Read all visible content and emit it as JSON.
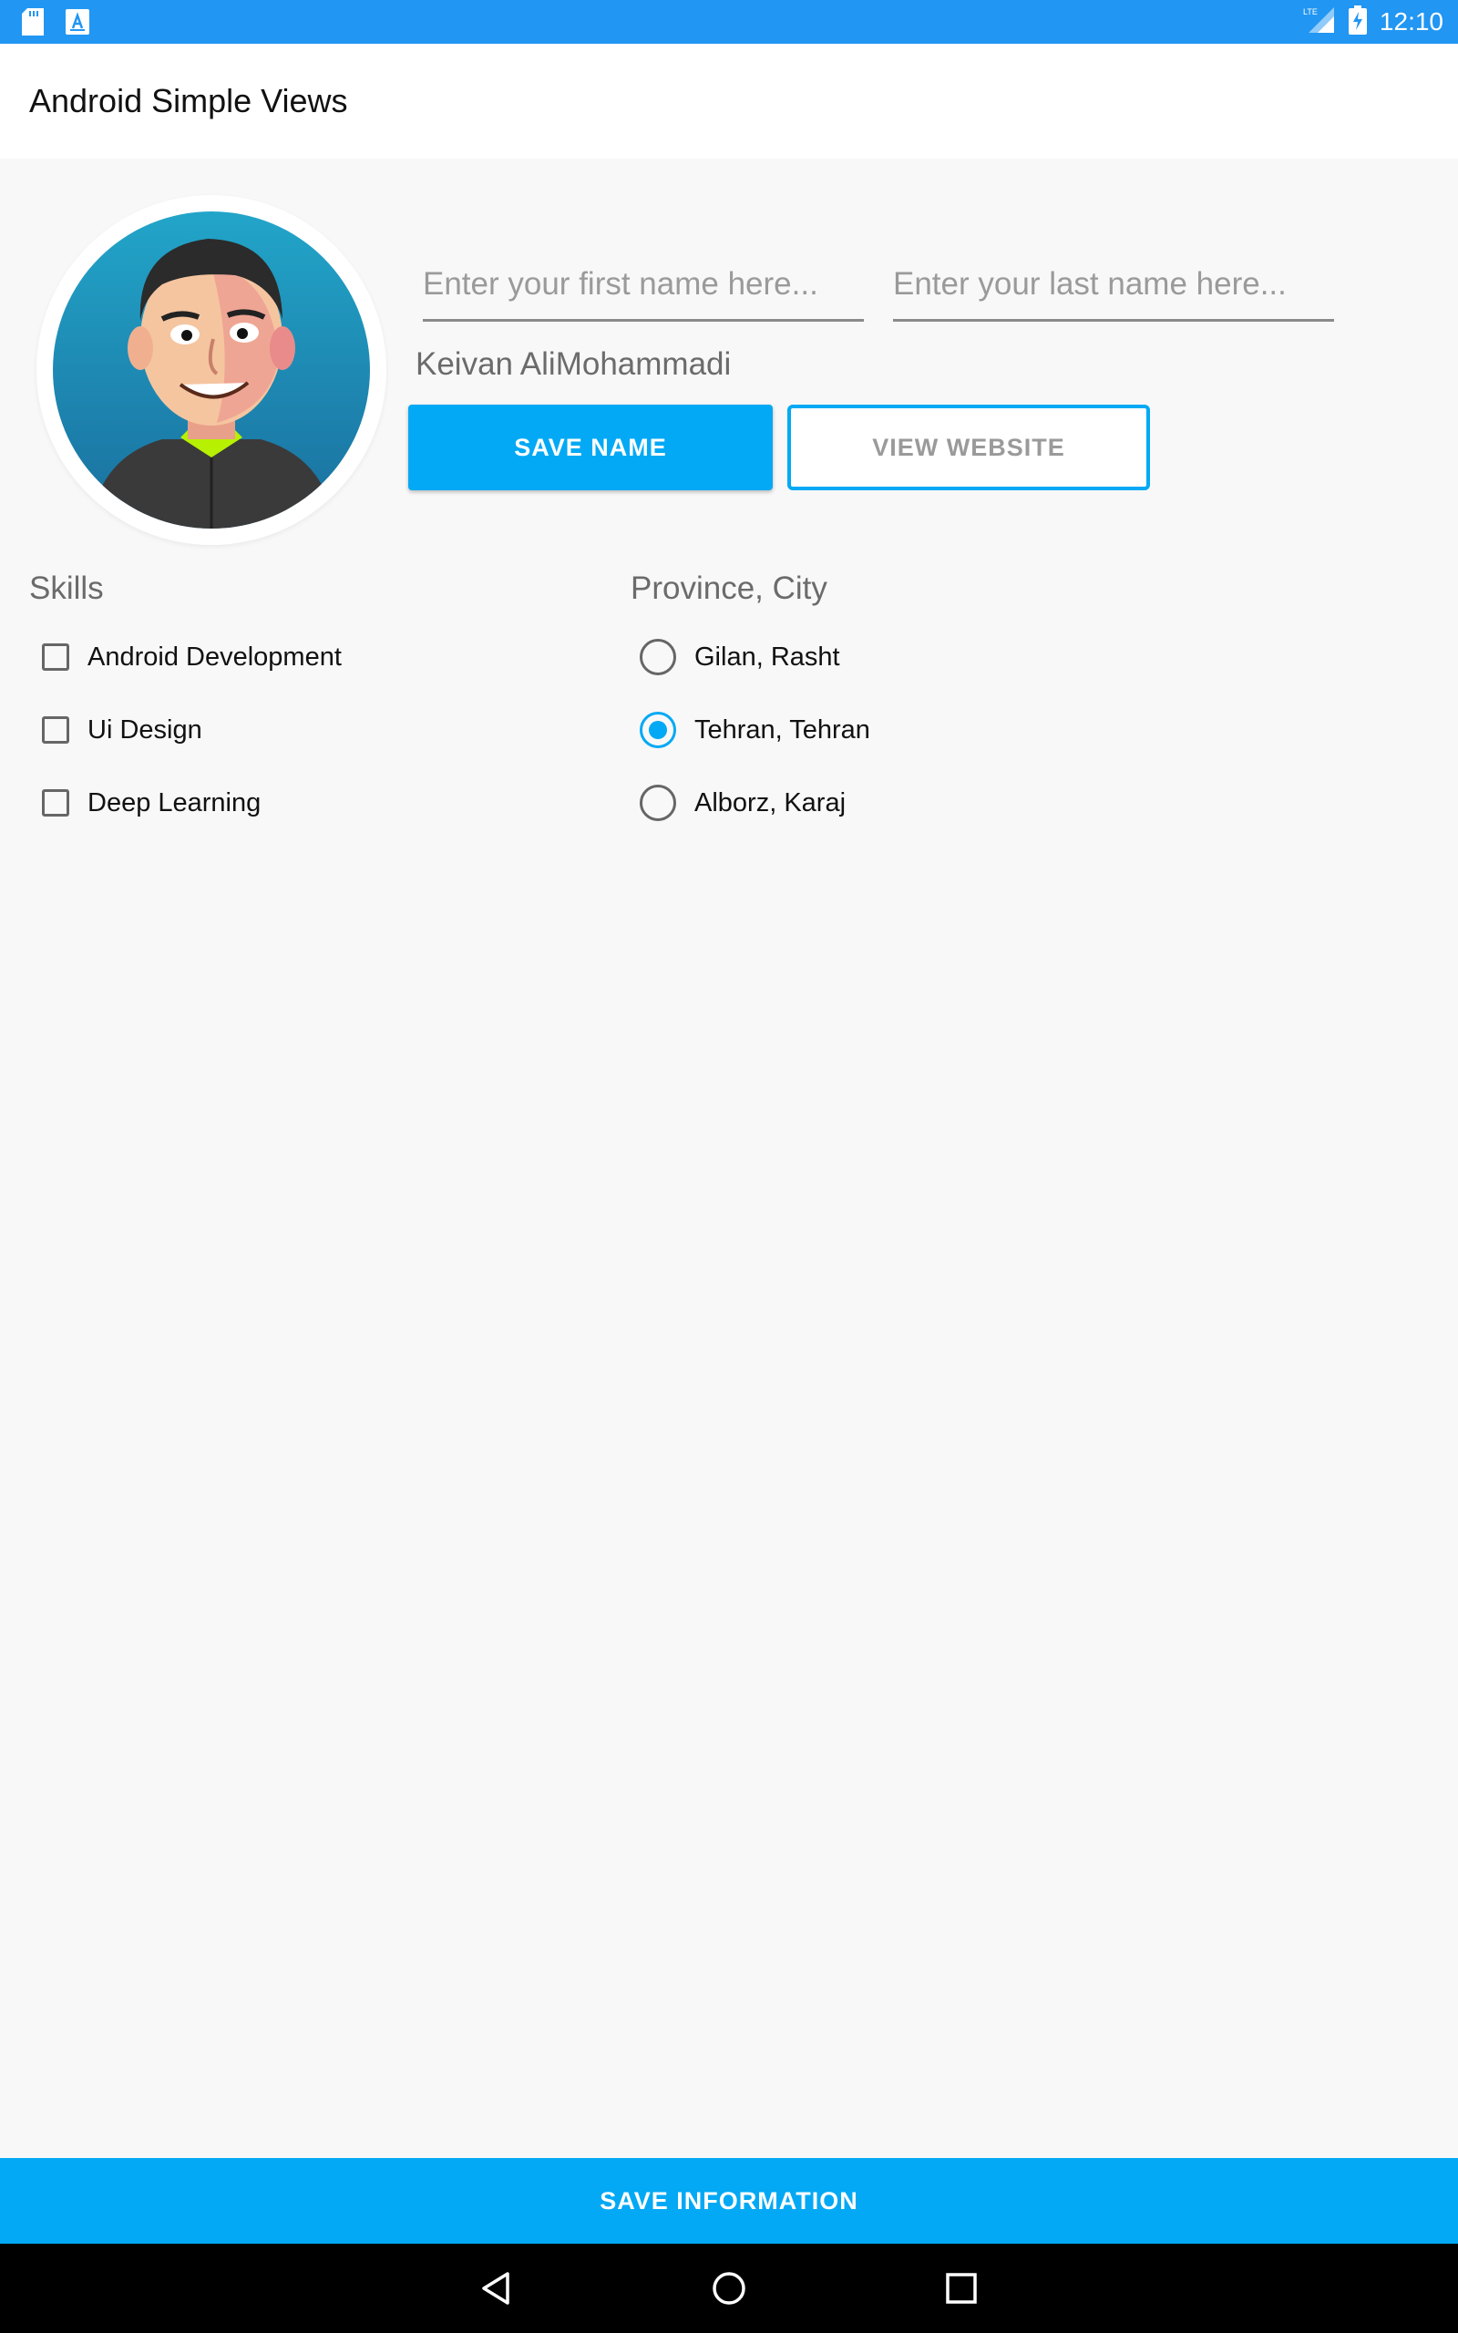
{
  "status_bar": {
    "time": "12:10",
    "left_icons": [
      "sd-card-icon",
      "text-a-icon"
    ],
    "right_icons": [
      "lte-signal-icon",
      "battery-charging-icon"
    ]
  },
  "app_bar": {
    "title": "Android Simple Views"
  },
  "profile": {
    "avatar": "avatar-cartoon-man",
    "first_name": {
      "value": "",
      "placeholder": "Enter your first name here..."
    },
    "last_name": {
      "value": "",
      "placeholder": "Enter your last name here..."
    },
    "full_name": "Keivan AliMohammadi",
    "save_name_label": "SAVE NAME",
    "view_website_label": "VIEW WEBSITE"
  },
  "skills": {
    "title": "Skills",
    "items": [
      {
        "label": "Android Development",
        "checked": false
      },
      {
        "label": "Ui Design",
        "checked": false
      },
      {
        "label": "Deep Learning",
        "checked": false
      }
    ]
  },
  "province": {
    "title": "Province, City",
    "options": [
      {
        "label": "Gilan, Rasht",
        "selected": false
      },
      {
        "label": "Tehran, Tehran",
        "selected": true
      },
      {
        "label": "Alborz, Karaj",
        "selected": false
      }
    ]
  },
  "save_information_label": "SAVE INFORMATION",
  "nav_bar": {
    "icons": [
      "back-icon",
      "home-icon",
      "recents-icon"
    ]
  },
  "colors": {
    "status_bar": "#2196f3",
    "accent": "#03a9f4",
    "background": "#f8f8f8"
  }
}
